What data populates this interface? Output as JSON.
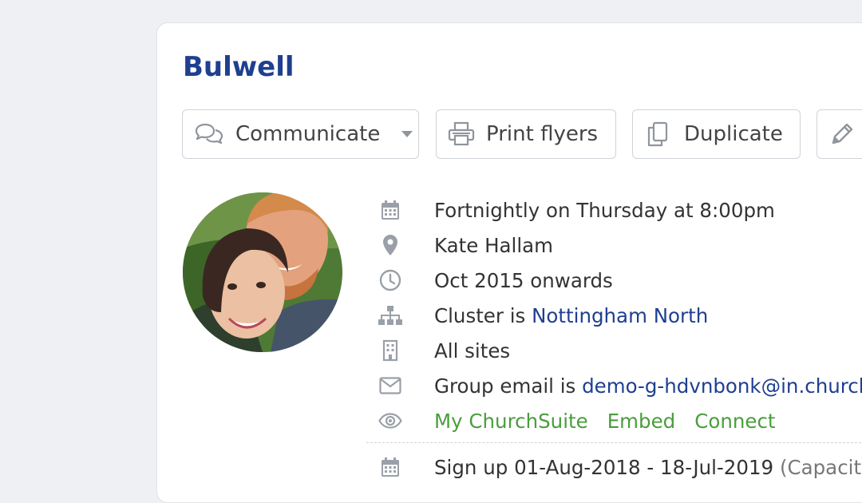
{
  "group": {
    "title": "Bulwell"
  },
  "toolbar": {
    "communicate_label": "Communicate",
    "print_label": "Print flyers",
    "duplicate_label": "Duplicate"
  },
  "details": {
    "schedule": "Fortnightly on Thursday at 8:00pm",
    "location": "Kate Hallam",
    "dates": "Oct 2015 onwards",
    "cluster_prefix": "Cluster is ",
    "cluster_link": "Nottingham North",
    "sites": "All sites",
    "email_prefix": "Group email is ",
    "email_link": "demo-g-hdvnbonk@in.church",
    "visibility_links": [
      "My ChurchSuite",
      "Embed",
      "Connect"
    ],
    "signup_text": "Sign up 01-Aug-2018 - 18-Jul-2019",
    "signup_capacity": "(Capacity:"
  },
  "icons": {
    "calendar": "calendar-icon",
    "map_marker": "map-marker-icon",
    "clock": "clock-icon",
    "sitemap": "sitemap-icon",
    "building": "building-icon",
    "envelope": "envelope-icon",
    "eye": "eye-icon"
  },
  "colors": {
    "title": "#1f3f8f",
    "link_blue": "#1f3f8f",
    "link_green": "#4a9d3d",
    "icon_gray": "#9aa0a8",
    "page_bg": "#eef0f4"
  }
}
